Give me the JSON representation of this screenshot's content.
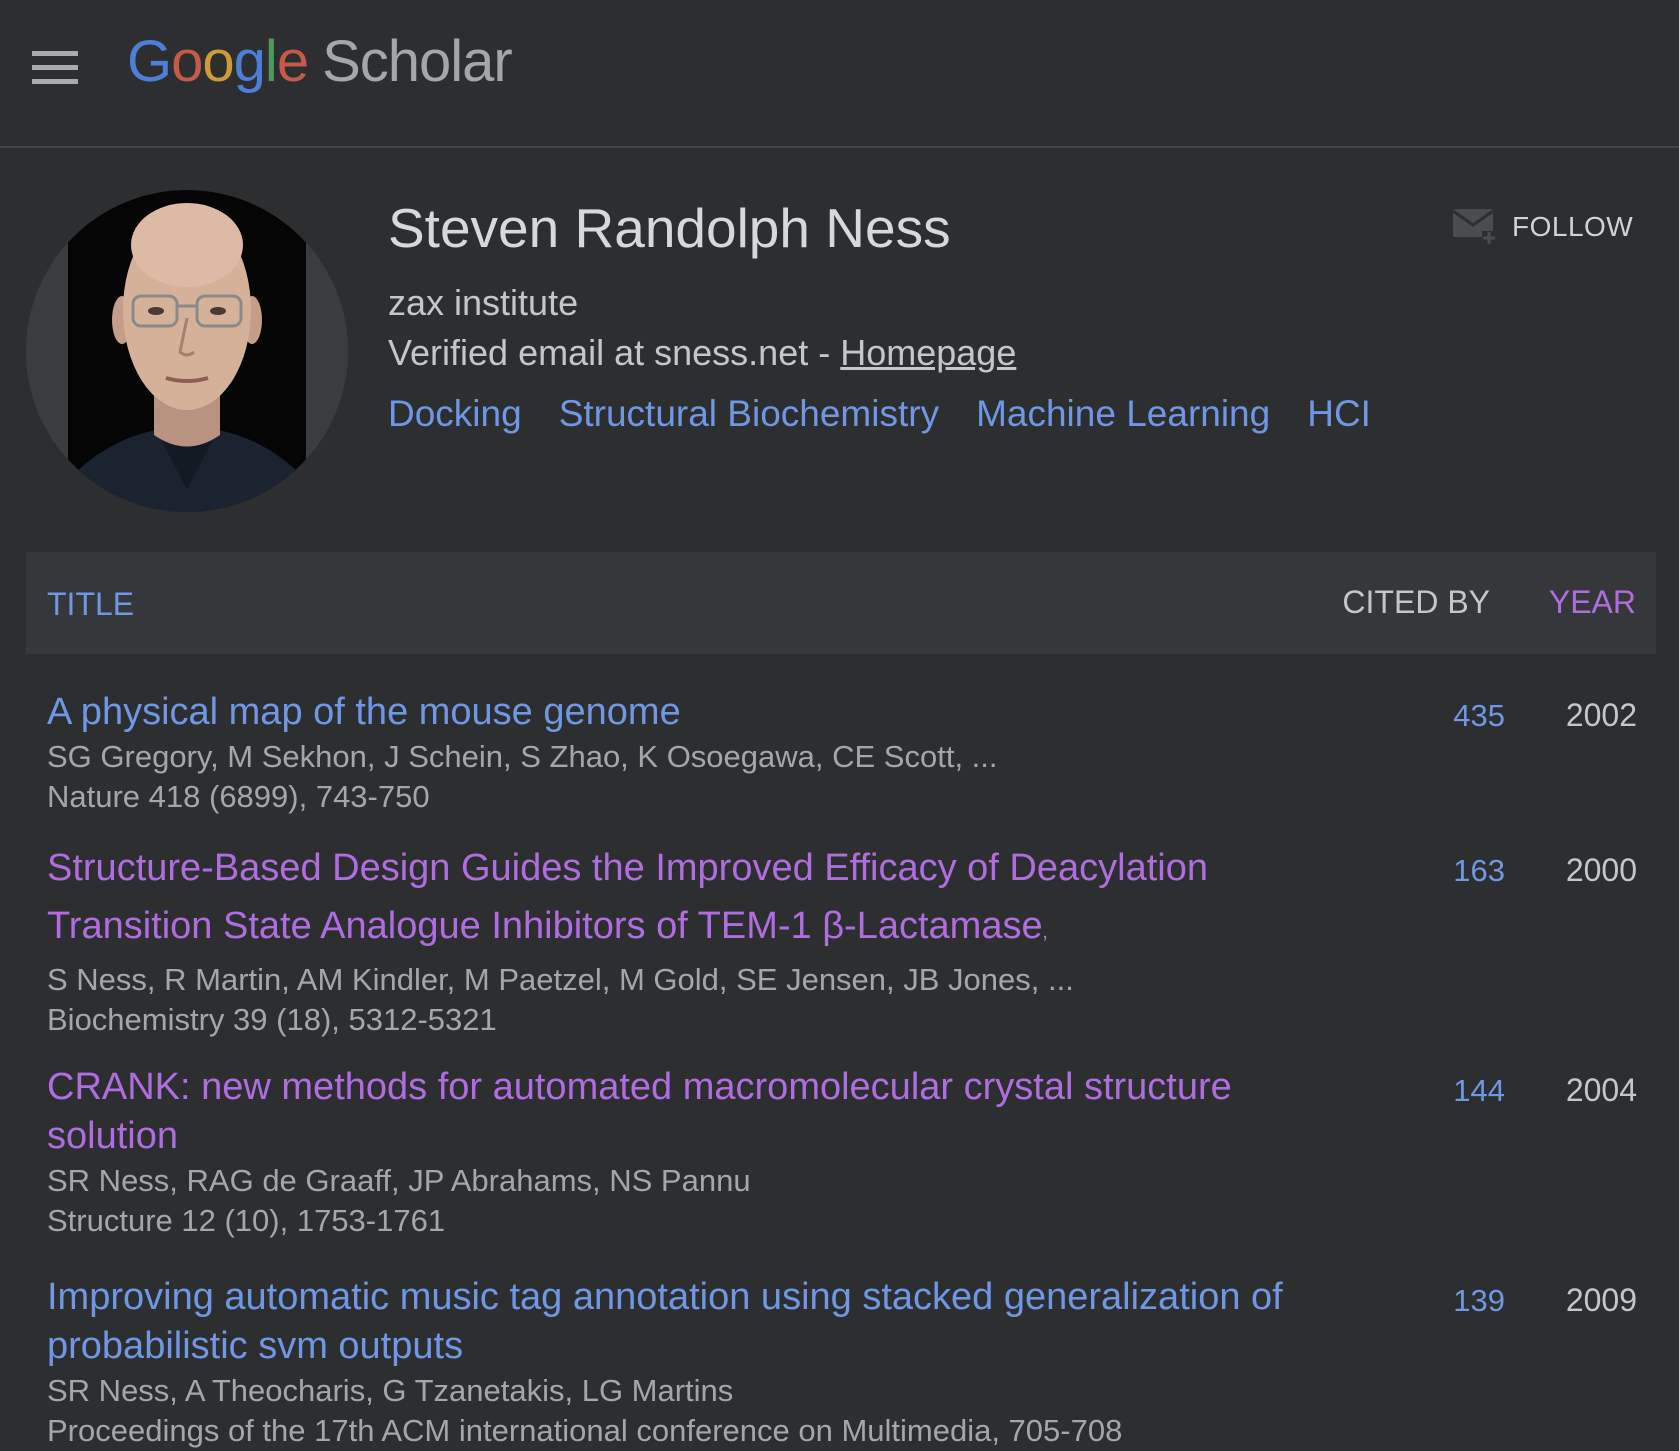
{
  "header": {
    "logo_letters": [
      "G",
      "o",
      "o",
      "g",
      "l",
      "e"
    ],
    "logo_product": "Scholar"
  },
  "profile": {
    "name": "Steven Randolph Ness",
    "affiliation": "zax institute",
    "email_text": "Verified email at sness.net - ",
    "homepage_label": "Homepage",
    "interests": [
      "Docking",
      "Structural Biochemistry",
      "Machine Learning",
      "HCI"
    ],
    "follow_label": "FOLLOW"
  },
  "table": {
    "col_title": "TITLE",
    "col_cited_by": "CITED BY",
    "col_year": "YEAR",
    "rows": [
      {
        "title": "A physical map of the mouse genome",
        "authors": "SG Gregory, M Sekhon, J Schein, S Zhao, K Osoegawa, CE Scott, ...",
        "venue": "Nature 418 (6899), 743-750",
        "cited_by": "435",
        "year": "2002"
      },
      {
        "title": "Structure-Based Design Guides the Improved Efficacy of Deacylation Transition State Analogue Inhibitors of TEM-1 β-Lactamase",
        "title_suffix": "‚",
        "authors": "S Ness, R Martin, AM Kindler, M Paetzel, M Gold, SE Jensen, JB Jones, ...",
        "venue": "Biochemistry 39 (18), 5312-5321",
        "cited_by": "163",
        "year": "2000"
      },
      {
        "title": "CRANK: new methods for automated macromolecular crystal structure solution",
        "authors": "SR Ness, RAG de Graaff, JP Abrahams, NS Pannu",
        "venue": "Structure 12 (10), 1753-1761",
        "cited_by": "144",
        "year": "2004"
      },
      {
        "title": "Improving automatic music tag annotation using stacked generalization of probabilistic svm outputs",
        "authors": "SR Ness, A Theocharis, G Tzanetakis, LG Martins",
        "venue": "Proceedings of the 17th ACM international conference on Multimedia, 705-708",
        "cited_by": "139",
        "year": "2009"
      }
    ]
  }
}
